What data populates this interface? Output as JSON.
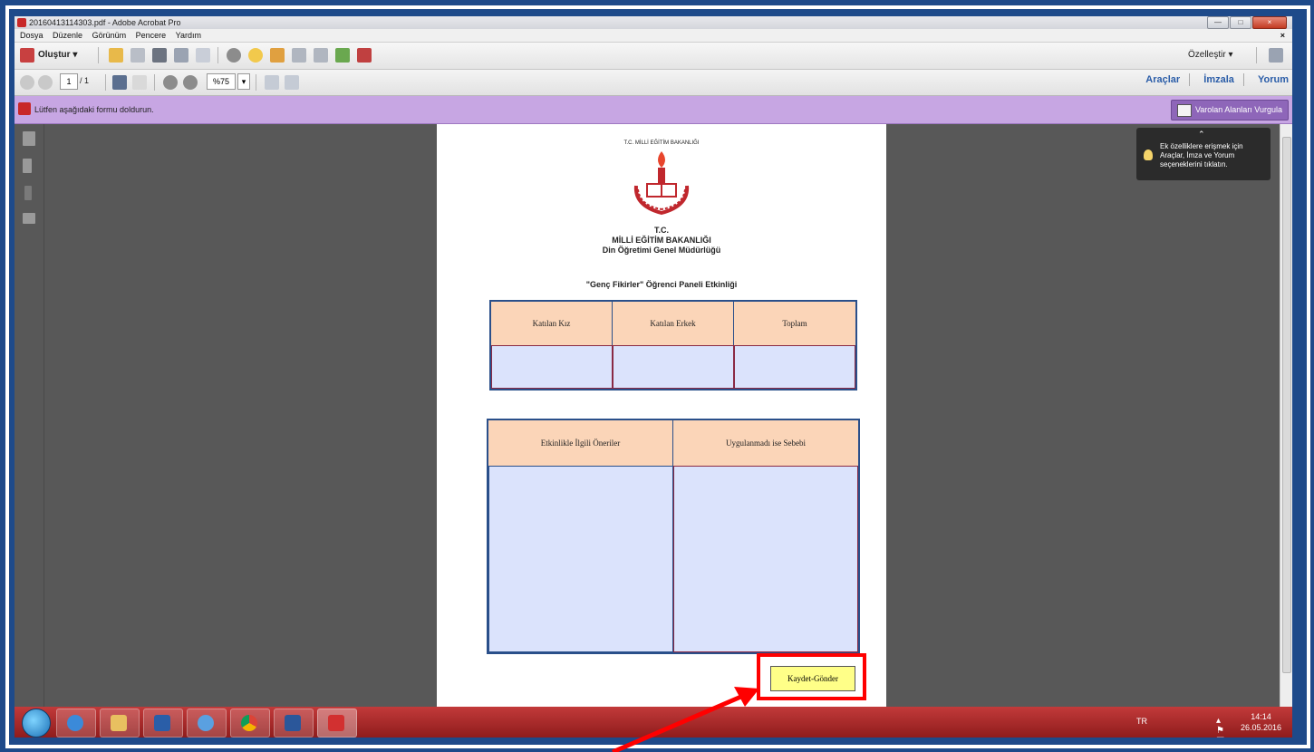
{
  "window": {
    "title": "20160413114303.pdf - Adobe Acrobat Pro",
    "close_symbol": "×"
  },
  "menu": [
    "Dosya",
    "Düzenle",
    "Görünüm",
    "Pencere",
    "Yardım"
  ],
  "toolbar": {
    "create_label": "Oluştur ▾",
    "customize_label": "Özelleştir ▾",
    "page_current": "1",
    "page_total": "/ 1",
    "zoom_value": "%75",
    "right_links": [
      "Araçlar",
      "İmzala",
      "Yorum"
    ]
  },
  "form_bar": {
    "message": "Lütfen aşağıdaki formu doldurun.",
    "highlight_button": "Varolan Alanları Vurgula"
  },
  "tooltip": {
    "text": "Ek özelliklere erişmek için Araçlar, İmza ve Yorum seçeneklerini tıklatın."
  },
  "document": {
    "logo_text": "T.C. MİLLİ EĞİTİM BAKANLIĞI",
    "header_lines": [
      "T.C.",
      "MİLLİ EĞİTİM BAKANLIĞI",
      "Din Öğretimi Genel Müdürlüğü"
    ],
    "activity_title": "\"Genç Fikirler\" Öğrenci Paneli Etkinliği",
    "table1_headers": [
      "Katılan Kız",
      "Katılan Erkek",
      "Toplam"
    ],
    "table2_headers": [
      "Etkinlikle İlgili Öneriler",
      "Uygulanmadı ise Sebebi"
    ],
    "save_button": "Kaydet-Gönder"
  },
  "taskbar": {
    "language": "TR",
    "time": "14:14",
    "date": "26.05.2016"
  },
  "colors": {
    "form_bar": "#c7a6e3",
    "table_header": "#fbd5b8",
    "input_field": "#dbe3fc",
    "save_button": "#ffff88",
    "highlight": "#ff0000",
    "taskbar": "#b03030"
  }
}
